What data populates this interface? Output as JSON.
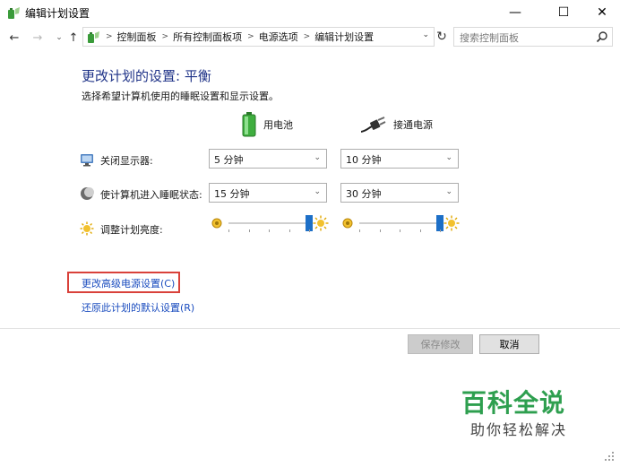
{
  "window": {
    "title": "编辑计划设置",
    "controls": {
      "minimize": "—",
      "maximize": "☐",
      "close": "✕"
    }
  },
  "navigation": {
    "back": "←",
    "forward": "→",
    "recent": "⌄",
    "up": "↑",
    "breadcrumbs": [
      "控制面板",
      "所有控制面板项",
      "电源选项",
      "编辑计划设置"
    ],
    "refresh": "↻",
    "search_placeholder": "搜索控制面板"
  },
  "plan": {
    "heading": "更改计划的设置: 平衡",
    "description": "选择希望计算机使用的睡眠设置和显示设置。",
    "columns": {
      "battery": "用电池",
      "plugged_in": "接通电源"
    },
    "settings": [
      {
        "label": "关闭显示器:",
        "icon": "monitor-icon",
        "battery": "5 分钟",
        "plugged_in": "10 分钟"
      },
      {
        "label": "使计算机进入睡眠状态:",
        "icon": "moon-icon",
        "battery": "15 分钟",
        "plugged_in": "30 分钟"
      }
    ],
    "brightness": {
      "label": "调整计划亮度:",
      "icon": "sun-icon",
      "battery_level": 1.0,
      "plugged_in_level": 1.0
    }
  },
  "links": {
    "advanced": "更改高级电源设置(C)",
    "restore": "还原此计划的默认设置(R)"
  },
  "buttons": {
    "save": "保存修改",
    "cancel": "取消"
  },
  "watermark": {
    "title": "百科全说",
    "subtitle": "助你轻松解决"
  },
  "colors": {
    "heading": "#1e3287",
    "link": "#1a4cbf",
    "highlight_box": "#d9413a",
    "slider_thumb": "#1d6fc7",
    "watermark": "#2e9f4f"
  }
}
